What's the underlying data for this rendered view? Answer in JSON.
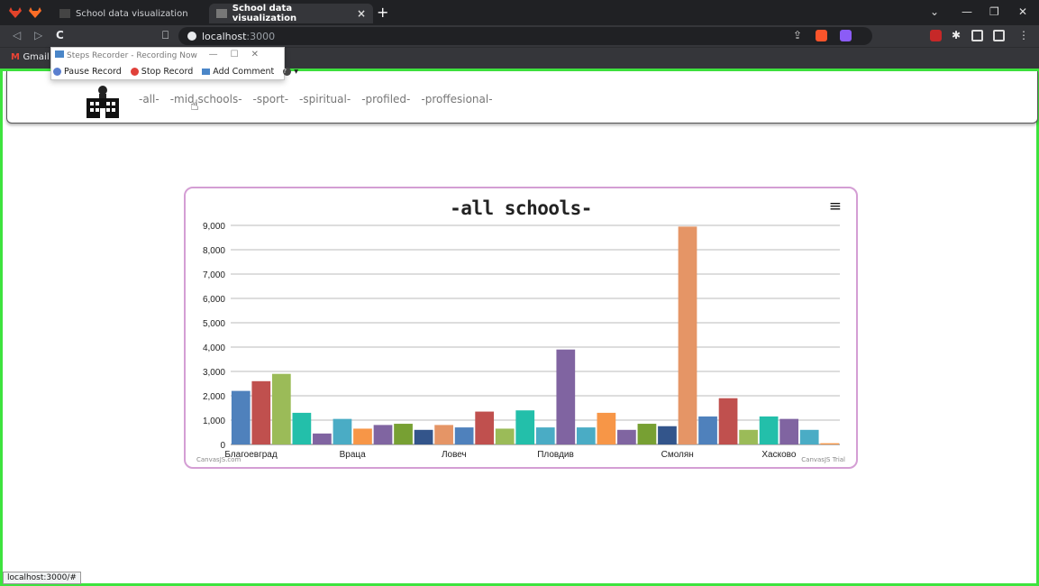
{
  "browser": {
    "tabs": [
      {
        "title": "School data visualization",
        "active": false
      },
      {
        "title": "School data visualization",
        "active": true
      }
    ],
    "close_glyph": "×",
    "add_glyph": "+",
    "url_host": "localhost",
    "url_port": ":3000",
    "bookmark": "Gmail",
    "status_url": "localhost:3000/#"
  },
  "recorder": {
    "title": "Steps Recorder - Recording Now",
    "pause": "Pause Record",
    "stop": "Stop Record",
    "comment": "Add Comment",
    "help": "?"
  },
  "site": {
    "menu": [
      "-all-",
      "-mid schools-",
      "-sport-",
      "-spiritual-",
      "-profiled-",
      "-proffesional-"
    ]
  },
  "chart_data": {
    "type": "bar",
    "title": "-all schools-",
    "ylim": [
      0,
      9000
    ],
    "yticks": [
      "0",
      "1,000",
      "2,000",
      "3,000",
      "4,000",
      "5,000",
      "6,000",
      "7,000",
      "8,000",
      "9,000"
    ],
    "categories": [
      "Благоевград",
      "Враца",
      "Ловеч",
      "Пловдив",
      "Смолян",
      "Хасково"
    ],
    "values": [
      2200,
      2600,
      2900,
      1300,
      450,
      1050,
      650,
      800,
      850,
      600,
      800,
      700,
      1350,
      650,
      1400,
      700,
      3900,
      700,
      1300,
      600,
      850,
      750,
      8950,
      1150,
      1900,
      600,
      1150,
      1050,
      600,
      50
    ],
    "colors": [
      "#4f81bc",
      "#c0504e",
      "#9bbb58",
      "#23bfaa",
      "#8064a1",
      "#4aacc5",
      "#f79647",
      "#8065a1",
      "#77a033",
      "#33558b",
      "#e59566",
      "#4f81bc",
      "#c0504e",
      "#9bbb58",
      "#23bfaa",
      "#4aacc5",
      "#8064a1",
      "#4aacc5",
      "#f79647",
      "#8065a1",
      "#77a033",
      "#33558b",
      "#e59566",
      "#4f81bc",
      "#c0504e",
      "#9bbb58",
      "#23bfaa",
      "#8064a1",
      "#4aacc5",
      "#f79647"
    ],
    "credit_left": "CanvasJS.com",
    "credit_right": "CanvasJS Trial",
    "menu_glyph": "≡"
  }
}
